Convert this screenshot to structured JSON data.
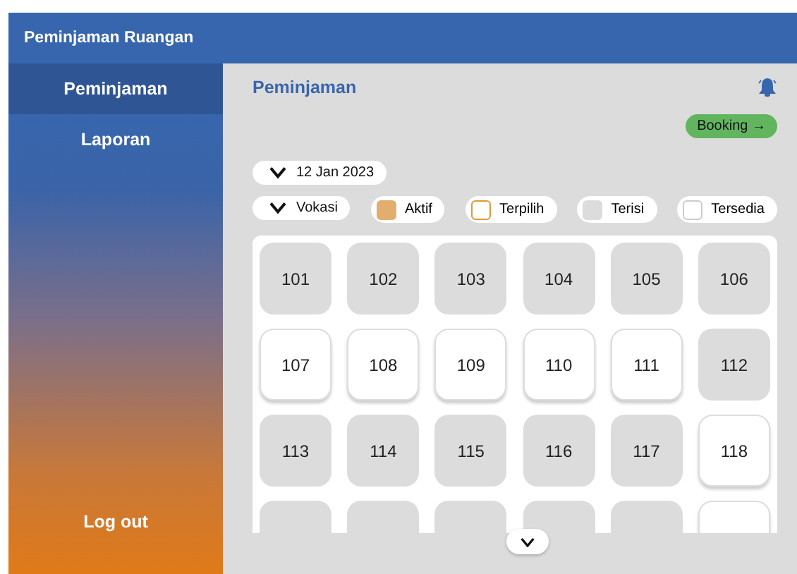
{
  "window": {
    "title": "Peminjaman Ruangan"
  },
  "sidebar": {
    "items": [
      {
        "label": "Peminjaman",
        "selected": true
      },
      {
        "label": "Laporan",
        "selected": false
      }
    ],
    "logout": "Log out"
  },
  "main": {
    "title": "Peminjaman",
    "booking_button": "Booking →",
    "date_filter": "12 Jan 2023",
    "faculty_filter": "Vokasi",
    "legend": [
      {
        "label": "Aktif",
        "kind": "aktif"
      },
      {
        "label": "Terpilih",
        "kind": "terpilih"
      },
      {
        "label": "Terisi",
        "kind": "terisi"
      },
      {
        "label": "Tersedia",
        "kind": "tersedia"
      }
    ],
    "rooms": [
      {
        "number": "101",
        "kind": "terisi"
      },
      {
        "number": "102",
        "kind": "terisi"
      },
      {
        "number": "103",
        "kind": "terisi"
      },
      {
        "number": "104",
        "kind": "terisi"
      },
      {
        "number": "105",
        "kind": "terisi"
      },
      {
        "number": "106",
        "kind": "terisi"
      },
      {
        "number": "107",
        "kind": "tersedia"
      },
      {
        "number": "108",
        "kind": "tersedia"
      },
      {
        "number": "109",
        "kind": "tersedia"
      },
      {
        "number": "110",
        "kind": "tersedia"
      },
      {
        "number": "111",
        "kind": "tersedia"
      },
      {
        "number": "112",
        "kind": "terisi"
      },
      {
        "number": "113",
        "kind": "terisi"
      },
      {
        "number": "114",
        "kind": "terisi"
      },
      {
        "number": "115",
        "kind": "terisi"
      },
      {
        "number": "116",
        "kind": "terisi"
      },
      {
        "number": "117",
        "kind": "terisi"
      },
      {
        "number": "118",
        "kind": "tersedia"
      },
      {
        "kind": "terisi"
      },
      {
        "kind": "terisi"
      },
      {
        "kind": "terisi"
      },
      {
        "kind": "terisi"
      },
      {
        "kind": "terisi"
      },
      {
        "kind": "tersedia"
      }
    ]
  }
}
